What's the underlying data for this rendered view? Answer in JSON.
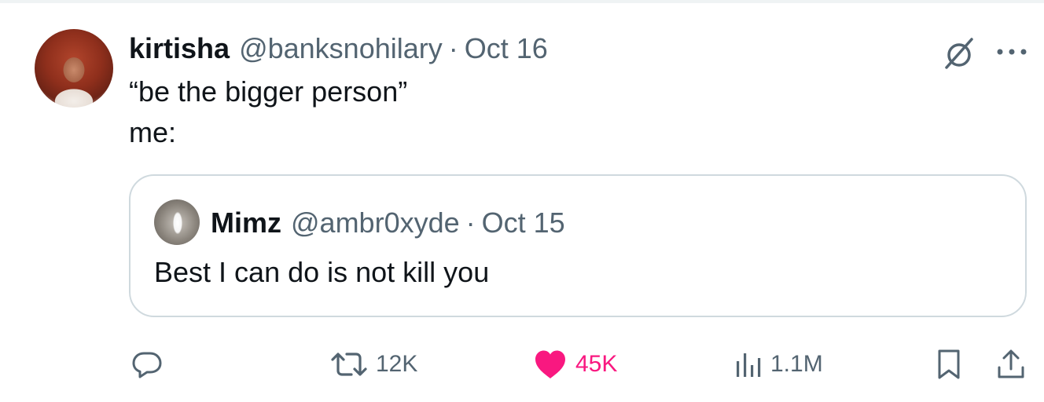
{
  "tweet": {
    "author_name": "kirtisha",
    "handle": "@banksnohilary",
    "separator": "·",
    "date": "Oct 16",
    "text_line1": "“be the bigger person”",
    "text_line2": "me:"
  },
  "quoted_tweet": {
    "author_name": "Mimz",
    "handle": "@ambr0xyde",
    "separator": "·",
    "date": "Oct 15",
    "text": "Best I can do is not kill you"
  },
  "actions": {
    "retweets": "12K",
    "likes": "45K",
    "views": "1.1M"
  },
  "icons": [
    "grok-icon",
    "more-icon",
    "reply-icon",
    "retweet-icon",
    "heart-icon",
    "views-icon",
    "bookmark-icon",
    "share-icon"
  ],
  "colors": {
    "text_primary": "#0f1419",
    "text_secondary": "#536471",
    "like_pink": "#f91880",
    "border": "#cfd9de"
  }
}
